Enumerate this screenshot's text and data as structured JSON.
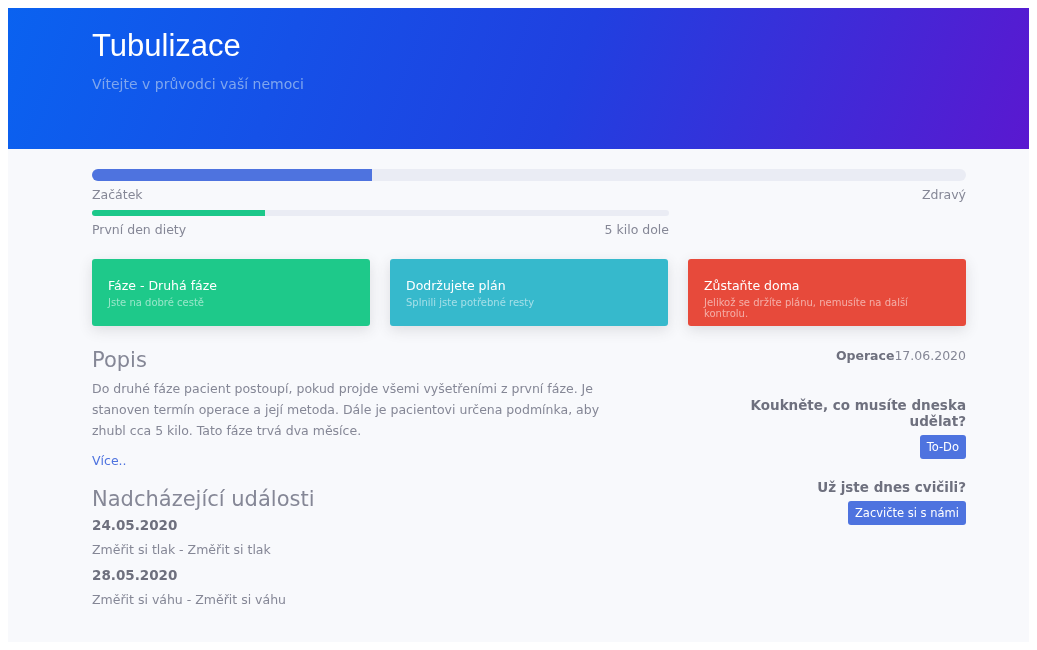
{
  "header": {
    "title": "Tubulizace",
    "subtitle": "Vítejte v průvodci vaší nemoci"
  },
  "progress": [
    {
      "level": 0.32,
      "start": "Začátek",
      "end": "Zdravý",
      "kind": "main"
    },
    {
      "level": 0.3,
      "start": "První den diety",
      "end": "5 kilo dole",
      "kind": "diet"
    }
  ],
  "cards": [
    {
      "title": "Fáze - Druhá fáze",
      "text": "Jste na dobré cestě",
      "color": "#1ec98a"
    },
    {
      "title": "Dodržujete plán",
      "text": "Splnili jste potřebné resty",
      "color": "#36b9cc"
    },
    {
      "title": "Zůstaňte doma",
      "text": "Jelikož se držíte plánu, nemusíte na další kontrolu.",
      "color": "#e74a3b"
    }
  ],
  "description": {
    "heading": "Popis",
    "text": "Do druhé fáze pacient postoupí, pokud projde všemi vyšetřeními z první fáze. Je stanoven termín operace a její metoda. Dále je pacientovi určena podmínka, aby zhubl cca 5 kilo. Tato fáze trvá dva měsíce.",
    "link": "Více.."
  },
  "events": {
    "heading": "Nadcházející události",
    "items": [
      {
        "date": "24.05.2020",
        "text": "Změřit si tlak - Změřit si tlak"
      },
      {
        "date": "28.05.2020",
        "text": "Změřit si váhu - Změřit si váhu"
      }
    ]
  },
  "sidebar": {
    "operation": "**Operace**17.06.2020",
    "prompts": [
      {
        "question": "Koukněte, co musíte dneska udělat?",
        "button": "To-Do"
      },
      {
        "question": "Už jste dnes cvičili?",
        "button": "Zacvičte si s námi"
      }
    ]
  }
}
